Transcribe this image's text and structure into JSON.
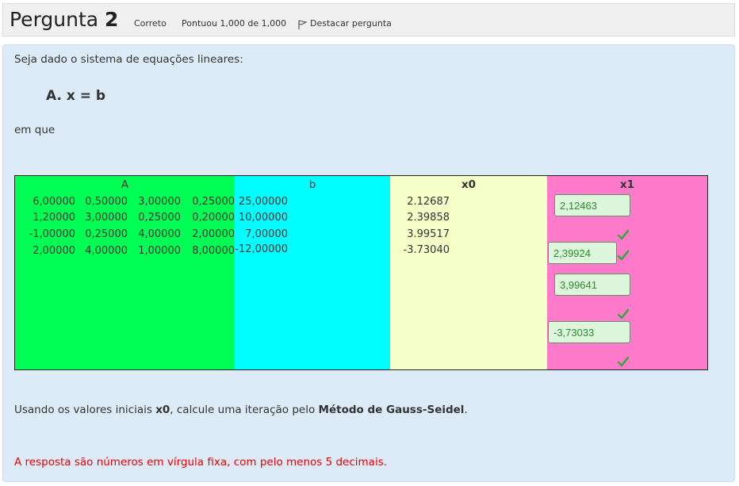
{
  "header": {
    "title_word": "Pergunta",
    "title_number": "2",
    "status": "Correto",
    "score": "Pontuou 1,000 de 1,000",
    "flag_label": "Destacar pergunta"
  },
  "question": {
    "intro": "Seja dado o sistema de equações lineares:",
    "equation": "A. x = b",
    "em_que": "em que",
    "instruction_prefix": "Usando os valores iniciais ",
    "instruction_x0": "x0",
    "instruction_middle": ", calcule uma iteração pelo ",
    "instruction_method": "Método de Gauss-Seidel",
    "instruction_end": ".",
    "note": "A resposta são números em vírgula fixa, com pelo menos 5 decimais."
  },
  "table": {
    "headers": {
      "A": "A",
      "b": "b",
      "x0": "x0",
      "x1": "x1"
    },
    "A": [
      [
        "6,00000",
        "0,50000",
        "3,00000",
        "0,25000"
      ],
      [
        "1,20000",
        "3,00000",
        "0,25000",
        "0,20000"
      ],
      [
        "-1,00000",
        "0,25000",
        "4,00000",
        "2,00000"
      ],
      [
        "2,00000",
        "4,00000",
        "1,00000",
        "8,00000"
      ]
    ],
    "b": [
      "25,00000",
      "10,00000",
      "7,00000",
      "-12,00000"
    ],
    "x0": [
      "2.12687",
      "2.39858",
      "3.99517",
      "-3.73040"
    ],
    "x1": [
      "2,12463",
      "2,39924",
      "3,99641",
      "-3,73033"
    ]
  },
  "colors": {
    "A": "#00ff55",
    "b": "#00ffff",
    "x0": "#f5ffc8",
    "x1": "#ff7acb",
    "correct": "#2e8b2e",
    "note": "#ee0000",
    "panel": "#dcebf7"
  },
  "icons": {
    "flag": "flag-icon",
    "check": "check-icon"
  }
}
